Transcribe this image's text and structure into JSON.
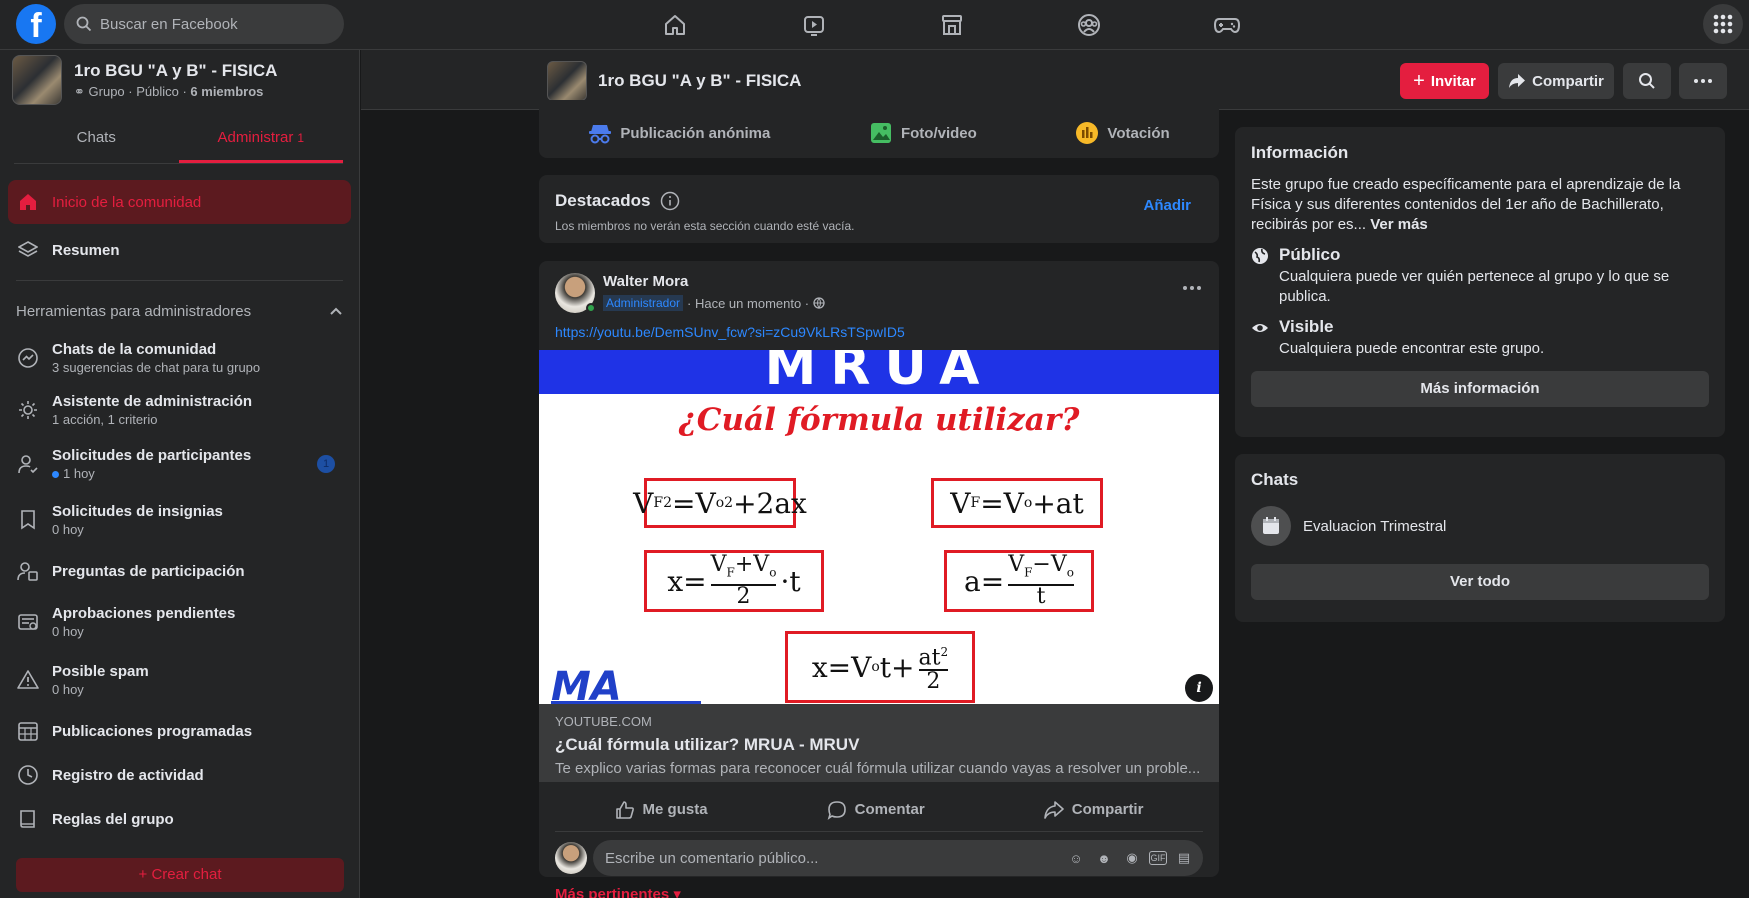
{
  "topbar": {
    "logo": "f",
    "search_placeholder": "Buscar en Facebook",
    "nav_icons": [
      "home-icon",
      "video-icon",
      "marketplace-icon",
      "groups-icon",
      "gaming-icon"
    ]
  },
  "sidebar": {
    "group_name": "1ro BGU \"A y B\" - FISICA",
    "group_meta": "Grupo · Público ·",
    "group_members": "6 miembros",
    "tabs": [
      {
        "label": "Chats"
      },
      {
        "label": "Administrar",
        "count": "1"
      }
    ],
    "active_item": "Inicio de la comunidad",
    "summary": "Resumen",
    "tools_heading": "Herramientas para administradores",
    "items": [
      {
        "title": "Chats de la comunidad",
        "sub": "3 sugerencias de chat para tu grupo"
      },
      {
        "title": "Asistente de administración",
        "sub": "1 acción, 1 criterio"
      },
      {
        "title": "Solicitudes de participantes",
        "sub": "1 hoy",
        "badge": "1"
      },
      {
        "title": "Solicitudes de insignias",
        "sub": "0 hoy"
      },
      {
        "title": "Preguntas de participación",
        "sub": ""
      },
      {
        "title": "Aprobaciones pendientes",
        "sub": "0 hoy"
      },
      {
        "title": "Posible spam",
        "sub": "0 hoy"
      },
      {
        "title": "Publicaciones programadas",
        "sub": ""
      },
      {
        "title": "Registro de actividad",
        "sub": ""
      },
      {
        "title": "Reglas del grupo",
        "sub": ""
      }
    ],
    "create_chat": "Crear chat"
  },
  "page_header": {
    "title": "1ro BGU \"A y B\" - FISICA",
    "invite": "Invitar",
    "share": "Compartir"
  },
  "compose": {
    "anon": "Publicación anónima",
    "photo": "Foto/video",
    "poll": "Votación"
  },
  "featured": {
    "title": "Destacados",
    "desc": "Los miembros no verán esta sección cuando esté vacía.",
    "add": "Añadir"
  },
  "post": {
    "author": "Walter Mora",
    "role": "Administrador",
    "time": "· Hace un momento ·",
    "link": "https://youtu.be/DemSUnv_fcw?si=zCu9VkLRsTSpwID5",
    "thumb_banner": "MRUA",
    "thumb_question": "¿Cuál fórmula utilizar?",
    "thumb_logo": "MA",
    "link_domain": "YOUTUBE.COM",
    "link_title": "¿Cuál fórmula utilizar? MRUA - MRUV",
    "link_desc": "Te explico varias formas para reconocer cuál fórmula utilizar cuando vayas a resolver un proble...",
    "like": "Me gusta",
    "comment": "Comentar",
    "share": "Compartir",
    "comment_placeholder": "Escribe un comentario público...",
    "more_relevant": "Más pertinentes ▾"
  },
  "about": {
    "title": "Información",
    "desc": "Este grupo fue creado específicamente para el aprendizaje de la Física y sus diferentes contenidos del 1er año de Bachillerato, recibirás por es...",
    "see_more": "Ver más",
    "public_title": "Público",
    "public_desc": "Cualquiera puede ver quién pertenece al grupo y lo que se publica.",
    "visible_title": "Visible",
    "visible_desc": "Cualquiera puede encontrar este grupo.",
    "more_info": "Más información"
  },
  "chats": {
    "title": "Chats",
    "item": "Evaluacion Trimestral",
    "see_all": "Ver todo"
  },
  "colors": {
    "accent_red": "#e41e3f",
    "link_blue": "#2d88ff",
    "bg": "#18191a",
    "card": "#242526"
  }
}
